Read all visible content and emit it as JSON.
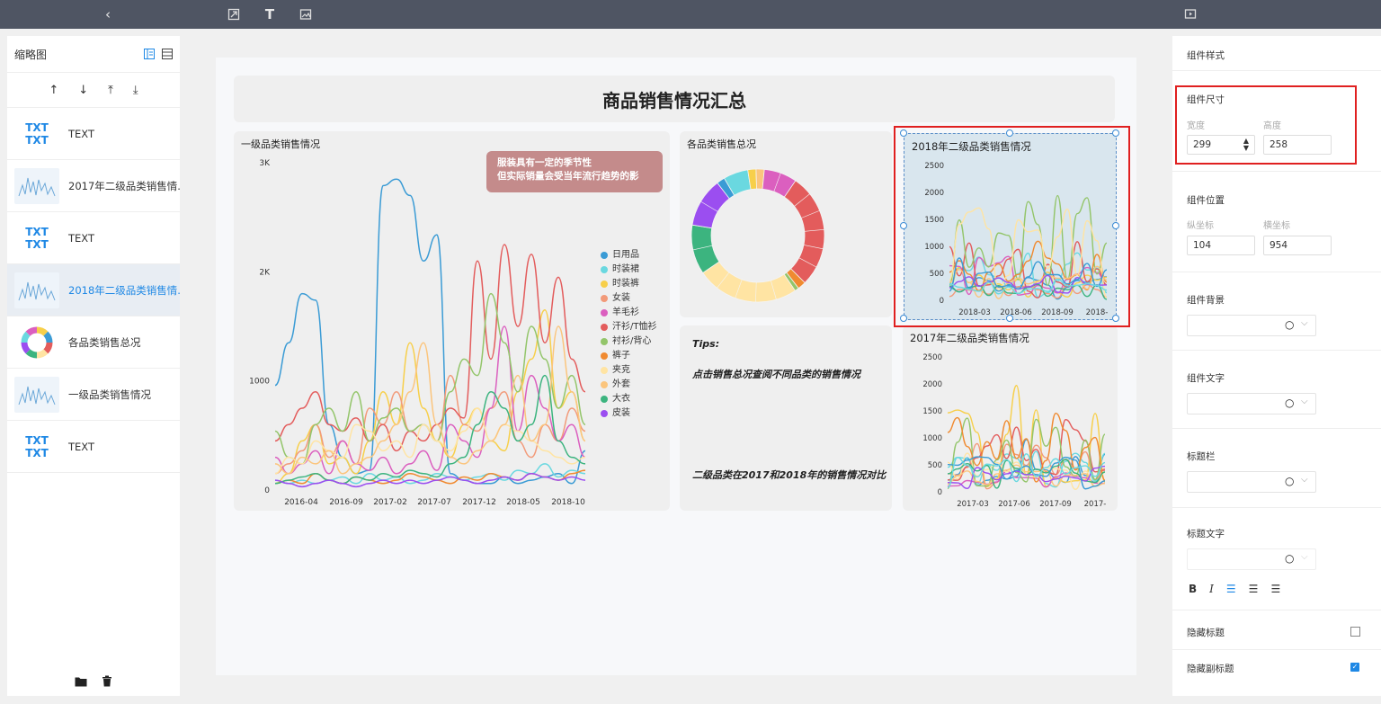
{
  "toolbar": {
    "icons": [
      "back-icon",
      "export-icon",
      "text-icon",
      "image-icon",
      "preview-icon"
    ]
  },
  "left_panel": {
    "title": "缩略图",
    "items": [
      {
        "label": "TEXT",
        "kind": "text"
      },
      {
        "label": "2017年二级品类销售情...",
        "kind": "line"
      },
      {
        "label": "TEXT",
        "kind": "text"
      },
      {
        "label": "2018年二级品类销售情...",
        "kind": "line",
        "active": true
      },
      {
        "label": "各品类销售总况",
        "kind": "donut"
      },
      {
        "label": "一级品类销售情况",
        "kind": "line"
      },
      {
        "label": "TEXT",
        "kind": "text"
      }
    ]
  },
  "canvas": {
    "title": "商品销售情况汇总",
    "main_chart_title": "一级品类销售情况",
    "note_line1": "服装具有一定的季节性",
    "note_line2": "但实际销量会受当年流行趋势的影",
    "donut_title": "各品类销售总况",
    "chart2018_title": "2018年二级品类销售情况",
    "chart2017_title": "2017年二级品类销售情况",
    "tips_title": "Tips:",
    "tips_line1": "点击销售总况查阅不同品类的销售情况",
    "tips_line2": "二级品类在2017和2018年的销售情况对比"
  },
  "chart_data": [
    {
      "type": "line",
      "title": "一级品类销售情况",
      "y_ticks": [
        "3K",
        "2K",
        "1000",
        "0"
      ],
      "x_ticks": [
        "2016-04",
        "2016-09",
        "2017-02",
        "2017-07",
        "2017-12",
        "2018-05",
        "2018-10"
      ],
      "ylim": [
        0,
        3000
      ],
      "legend": [
        "日用品",
        "时装裙",
        "时装裤",
        "女装",
        "羊毛衫",
        "汗衫/T恤衫",
        "衬衫/背心",
        "裤子",
        "夹克",
        "外套",
        "大衣",
        "皮装"
      ],
      "colors": [
        "#3a9bd5",
        "#6ad8e0",
        "#f7cf4a",
        "#f29a79",
        "#db5fbf",
        "#e35c5c",
        "#93c56a",
        "#f08a30",
        "#ffe4a3",
        "#fbc57d",
        "#3cb47f",
        "#9b4ef0"
      ]
    },
    {
      "type": "pie",
      "title": "各品类销售总况"
    },
    {
      "type": "line",
      "title": "2018年二级品类销售情况",
      "y_ticks": [
        "2500",
        "2000",
        "1500",
        "1000",
        "500",
        "0"
      ],
      "x_ticks": [
        "2018-03",
        "2018-06",
        "2018-09",
        "2018-"
      ],
      "ylim": [
        0,
        2500
      ]
    },
    {
      "type": "line",
      "title": "2017年二级品类销售情况",
      "y_ticks": [
        "2500",
        "2000",
        "1500",
        "1000",
        "500",
        "0"
      ],
      "x_ticks": [
        "2017-03",
        "2017-06",
        "2017-09",
        "2017-"
      ],
      "ylim": [
        0,
        2500
      ]
    }
  ],
  "right_panel": {
    "title": "组件样式",
    "size_label": "组件尺寸",
    "width_label": "宽度",
    "height_label": "高度",
    "width_value": "299",
    "height_value": "258",
    "pos_label": "组件位置",
    "y_label": "纵坐标",
    "x_label": "横坐标",
    "y_value": "104",
    "x_value": "954",
    "bg_label": "组件背景",
    "text_label": "组件文字",
    "titlebar_label": "标题栏",
    "titletext_label": "标题文字",
    "hide_title_label": "隐藏标题",
    "hide_subtitle_label": "隐藏副标题"
  }
}
